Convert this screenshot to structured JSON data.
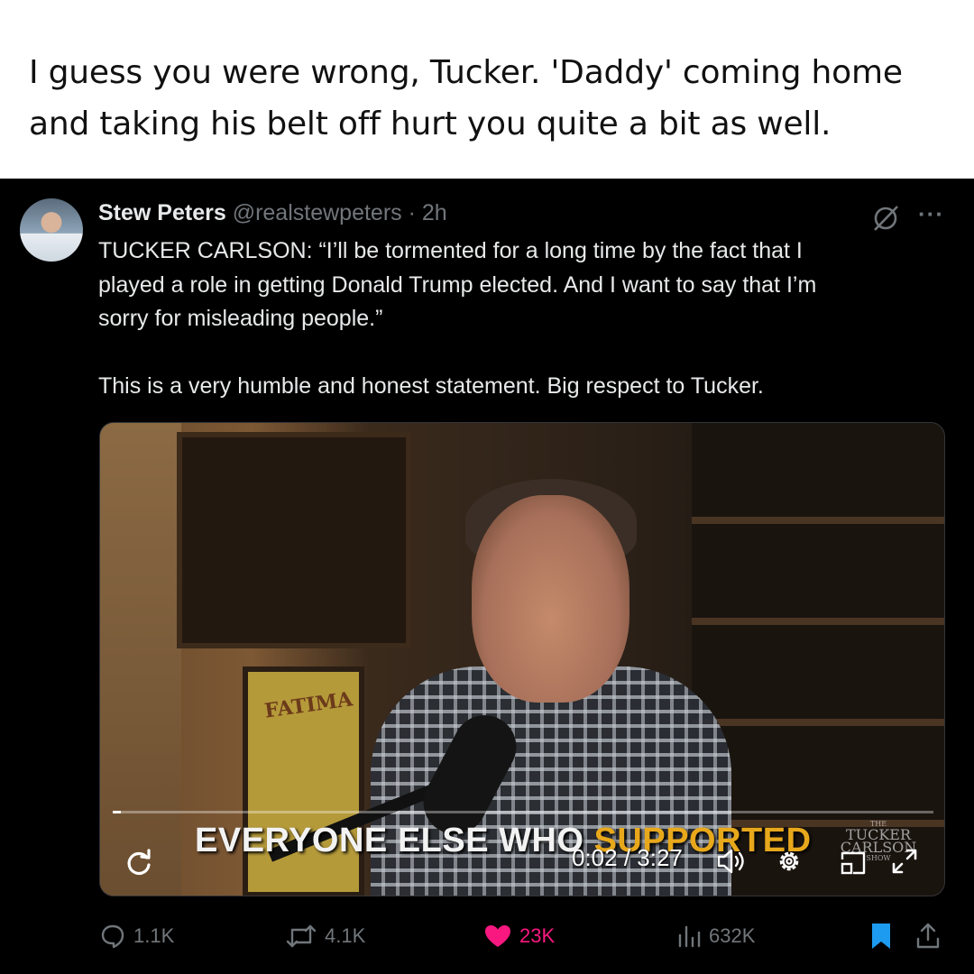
{
  "caption": {
    "line1": "I guess you were wrong, Tucker. 'Daddy' coming home",
    "line2": "and taking his belt off hurt you quite a bit as well."
  },
  "tweet": {
    "author_name": "Stew Peters",
    "handle": "@realstewpeters",
    "separator": " · ",
    "time": "2h",
    "more_label": "···",
    "text": "TUCKER CARLSON: “I’ll be tormented for a long time by the fact that I\nplayed a role in getting Donald Trump elected. And I want to say that I’m\nsorry for misleading people.”\n\nThis is a very humble and honest statement. Big respect to Tucker."
  },
  "video": {
    "subtitle_plain": "EVERYONE ELSE WHO ",
    "subtitle_highlight": "SUPPORTED",
    "time": "0:02 / 3:27",
    "progress": 0.01,
    "poster_text": "FATIMA",
    "watermark_line1": "THE",
    "watermark_line2": "TUCKER",
    "watermark_line3": "CARLSON",
    "watermark_line4": "SHOW"
  },
  "actions": {
    "replies": "1.1K",
    "reposts": "4.1K",
    "likes": "23K",
    "views": "632K"
  },
  "colors": {
    "like": "#f91880",
    "bookmark": "#1d9bf0",
    "muted": "#71767b",
    "subtitle_highlight": "#e8a81c"
  },
  "icons": [
    "grok-icon",
    "more-icon",
    "replay-icon",
    "volume-icon",
    "gear-icon",
    "pip-icon",
    "fullscreen-icon",
    "reply-icon",
    "repost-icon",
    "heart-icon",
    "views-icon",
    "bookmark-icon",
    "share-icon"
  ]
}
